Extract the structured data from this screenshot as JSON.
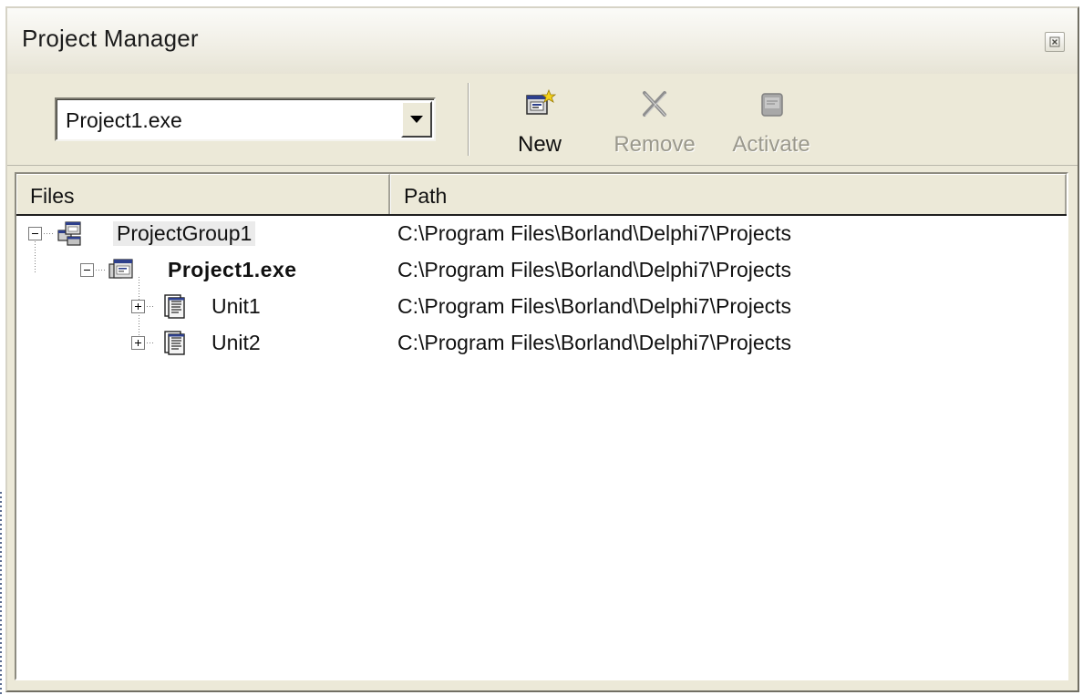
{
  "window": {
    "title": "Project Manager",
    "close_icon": "close-icon"
  },
  "toolbar": {
    "project_select": {
      "value": "Project1.exe",
      "icon": "chevron-down-icon"
    },
    "buttons": [
      {
        "id": "new",
        "label": "New",
        "icon": "new-project-icon",
        "enabled": true
      },
      {
        "id": "remove",
        "label": "Remove",
        "icon": "remove-x-icon",
        "enabled": false
      },
      {
        "id": "activate",
        "label": "Activate",
        "icon": "activate-icon",
        "enabled": false
      }
    ]
  },
  "columns": [
    "Files",
    "Path"
  ],
  "tree": [
    {
      "name": "ProjectGroup1",
      "path": "C:\\Program Files\\Borland\\Delphi7\\Projects",
      "icon": "project-group-icon",
      "expander": "minus",
      "bold": false,
      "highlighted": true
    },
    {
      "name": "Project1.exe",
      "path": "C:\\Program Files\\Borland\\Delphi7\\Projects",
      "icon": "project-exe-icon",
      "expander": "minus",
      "bold": true,
      "highlighted": false
    },
    {
      "name": "Unit1",
      "path": "C:\\Program Files\\Borland\\Delphi7\\Projects",
      "icon": "unit-file-icon",
      "expander": "plus",
      "bold": false,
      "highlighted": false
    },
    {
      "name": "Unit2",
      "path": "C:\\Program Files\\Borland\\Delphi7\\Projects",
      "icon": "unit-file-icon",
      "expander": "plus",
      "bold": false,
      "highlighted": false
    }
  ],
  "colors": {
    "window_bg": "#ece9d8",
    "disabled_text": "#9a988c",
    "selection_tint": "#ebebeb"
  }
}
